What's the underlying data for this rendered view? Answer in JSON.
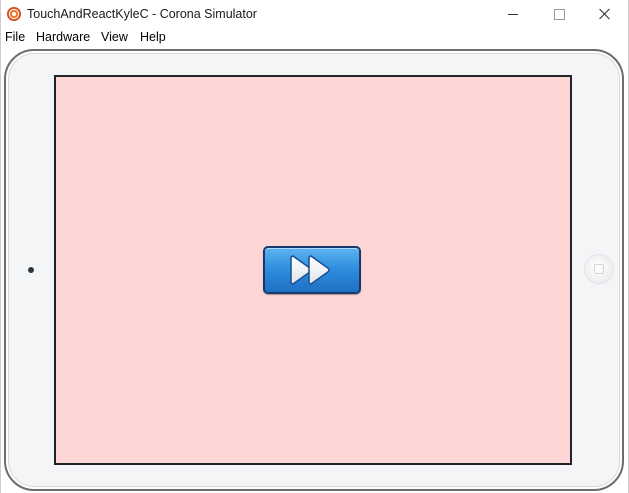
{
  "window": {
    "title": "TouchAndReactKyleC - Corona Simulator",
    "app_icon": "corona-simulator-icon",
    "controls": {
      "minimize": "minimize-icon",
      "maximize": "maximize-icon",
      "close": "close-icon"
    }
  },
  "menubar": {
    "items": [
      {
        "label": "File"
      },
      {
        "label": "Hardware"
      },
      {
        "label": "View"
      },
      {
        "label": "Help"
      }
    ]
  },
  "device": {
    "model": "tablet-frame",
    "screen_background": "#ffd6d6",
    "frame_color": "#f4f5f7",
    "screen_content": {
      "button": {
        "icon": "fast-forward-icon",
        "color": "#2f8fe0",
        "border_color": "#143a6e"
      }
    }
  }
}
